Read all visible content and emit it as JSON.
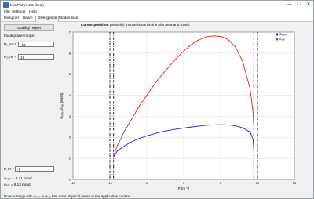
{
  "window": {
    "title": "LinaPlot v1.0.0 (beta)",
    "minimize": "—",
    "maximize": "☐",
    "close": "✕"
  },
  "menu": [
    "File",
    "Settings",
    "Help"
  ],
  "tabs": [
    "Designer",
    "Beam",
    "Divergence",
    "Modes loss"
  ],
  "left": {
    "button": "Stability region",
    "focal_label": "Focal power range:",
    "p1_label": "P₁, m⁻¹",
    "p1_value": "-15",
    "p2_label": "P₂, m⁻¹",
    "p2_value": "15",
    "pt_label": "P, m⁻¹",
    "pt_value": "-1",
    "sigma_perp": "σₚₑᵣₚ = 2.41 mrad",
    "sigma_par": "σₚₐᵣ = 6.13 mrad"
  },
  "cursor": {
    "label": "Cursor position:",
    "text": "press left mouse button in the plot area and travel."
  },
  "note": "Note: a range with σₚₑᵣₚ > σₚₐᵣ has not a physical sense in the application context.",
  "chart_data": {
    "type": "line",
    "xlabel": "P (m⁻¹)",
    "ylabel": "σₚₑᵣₚ, σₚₐᵣ (mrad)",
    "xlim": [
      -15,
      15
    ],
    "ylim": [
      0,
      7
    ],
    "xticks": [
      -15,
      -10,
      -5,
      0,
      5,
      10,
      15
    ],
    "yticks": [
      0,
      1,
      2,
      3,
      4,
      5,
      6,
      7
    ],
    "grid": true,
    "legend_position": "top-right",
    "vlines": [
      -10,
      -9.5,
      9.5,
      10
    ],
    "series": [
      {
        "name": "σₚₑᵣₚ",
        "color": "#1f1fe0",
        "x": [
          -9.5,
          -9.0,
          -8.0,
          -7.0,
          -6.0,
          -5.0,
          -4.0,
          -3.0,
          -2.0,
          -1.0,
          0.0,
          1.0,
          2.0,
          3.0,
          4.0,
          5.0,
          6.0,
          7.0,
          8.0,
          9.0,
          9.4,
          9.5
        ],
        "y": [
          1.05,
          1.35,
          1.6,
          1.8,
          1.95,
          2.07,
          2.17,
          2.26,
          2.33,
          2.39,
          2.44,
          2.49,
          2.53,
          2.57,
          2.59,
          2.6,
          2.59,
          2.55,
          2.45,
          2.25,
          1.9,
          1.4
        ]
      },
      {
        "name": "σₚₐᵣ",
        "color": "#e02020",
        "x": [
          -9.5,
          -9.0,
          -8.0,
          -7.0,
          -6.0,
          -5.0,
          -4.0,
          -3.0,
          -2.0,
          -1.0,
          0.0,
          1.0,
          2.0,
          3.0,
          4.0,
          5.0,
          6.0,
          7.0,
          8.0,
          9.0,
          9.4,
          9.5
        ],
        "y": [
          1.1,
          1.6,
          2.3,
          2.9,
          3.5,
          4.0,
          4.5,
          4.95,
          5.35,
          5.75,
          6.1,
          6.4,
          6.62,
          6.77,
          6.82,
          6.8,
          6.65,
          6.3,
          5.6,
          4.3,
          3.2,
          2.5
        ]
      }
    ]
  }
}
